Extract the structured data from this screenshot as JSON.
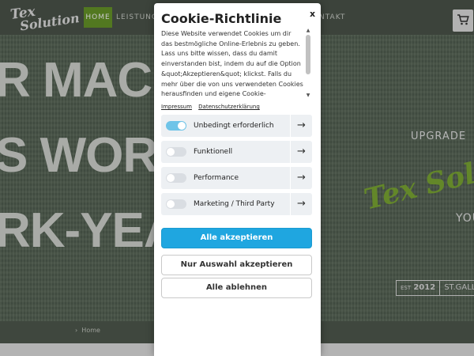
{
  "site": {
    "logo": {
      "line1": "Tex",
      "line2": "Solution"
    },
    "nav": [
      {
        "label": "HOME"
      },
      {
        "label": "LEISTUNGEN"
      },
      {
        "label": "NTAKT"
      }
    ],
    "hero": {
      "lines": [
        "R MACH",
        "S WORK",
        "RK-YEA"
      ],
      "upgrade": "UPGRADE",
      "brand": "Tex Solution",
      "you": "YOU",
      "est_label": "EST",
      "est_year": "2012",
      "location": "ST.GALLEN"
    },
    "breadcrumb": "Home",
    "cart_icon": "shopping-cart-icon"
  },
  "cookie": {
    "title": "Cookie-Richtlinie",
    "close": "x",
    "description": "Diese Website verwendet Cookies um dir das bestmögliche Online-Erlebnis zu geben. Lass uns bitte wissen, dass du damit einverstanden bist, indem du auf die Option &quot;Akzeptieren&quot; klickst. Falls du mehr über die von uns verwendeten Cookies herausfinden und eigene Cookie-",
    "links": {
      "impressum": "Impressum",
      "privacy": "Datenschutzerklärung"
    },
    "categories": [
      {
        "label": "Unbedingt erforderlich",
        "enabled": true
      },
      {
        "label": "Funktionell",
        "enabled": false
      },
      {
        "label": "Performance",
        "enabled": false
      },
      {
        "label": "Marketing / Third Party",
        "enabled": false
      }
    ],
    "arrow": "→",
    "buttons": {
      "accept_all": "Alle akzeptieren",
      "accept_selection": "Nur Auswahl akzeptieren",
      "reject_all": "Alle ablehnen"
    },
    "colors": {
      "primary": "#1fa6e0",
      "toggle_on": "#6fc4e8",
      "category_bg": "#edf0f3"
    }
  }
}
